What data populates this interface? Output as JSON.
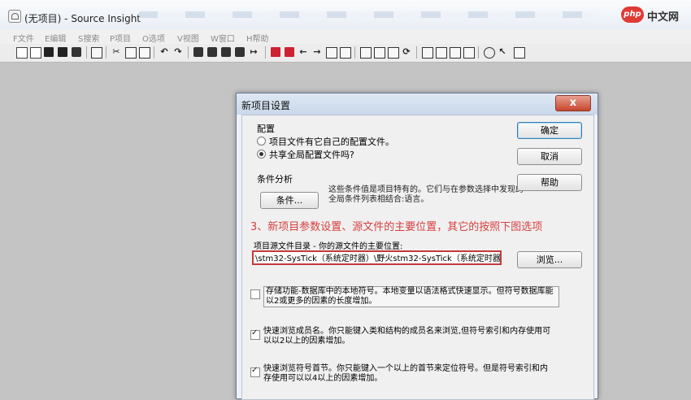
{
  "window": {
    "title": "(无项目) - Source Insight",
    "brand": {
      "badge": "php",
      "text": "中文网"
    }
  },
  "menu": [
    "F文件",
    "E编辑",
    "S搜索",
    "P项目",
    "O选项",
    "V视图",
    "W窗口",
    "H帮助"
  ],
  "toolbar": {
    "icons": [
      "new-file-icon",
      "open-icon",
      "save-icon",
      "save-all-icon",
      "close-file-icon",
      "print-icon",
      "cut-icon",
      "copy-icon",
      "paste-icon",
      "undo-icon",
      "redo-icon",
      "search-icon",
      "search-files-icon",
      "lookup-icon",
      "replace-icon",
      "goto-icon",
      "bookmark-icon",
      "bookmark-list-icon",
      "back-icon",
      "forward-icon",
      "jump-icon",
      "jump-return-icon",
      "project-window-icon",
      "symbol-window-icon",
      "context-window-icon",
      "relation-window-icon",
      "layout-icon",
      "window-icon",
      "split-icon",
      "tile-icon",
      "browse-icon",
      "pointer-icon",
      "more-icon"
    ]
  },
  "dialog": {
    "title": "新项目设置",
    "close_glyph": "x",
    "config_title": "配置",
    "radio_own": "项目文件有它自己的配置文件。",
    "radio_global": "共享全局配置文件吗?",
    "conditions_title": "条件分析",
    "conditions_button": "条件...",
    "conditions_desc": "这些条件值是项目特有的。它们与在参数选择中发现的全局条件列表相结合:语言。",
    "annotation": "3、新项目参数设置、源文件的主要位置，其它的按照下图选项",
    "path_label": "项目源文件目录 - 你的源文件的主要位置:",
    "path_value": "\\stm32-SysTick（系统定时器）\\野火stm32-SysTick（系统定时器）",
    "buttons": {
      "ok": "确定",
      "cancel": "取消",
      "help": "帮助",
      "browse": "浏览..."
    },
    "options": [
      {
        "text": "存储功能-数据库中的本地符号。本地变量以语法格式快速显示。但符号数据库能以2或更多的因素的长度增加。",
        "checked": false
      },
      {
        "text": "快速浏览成员名。你只能键入类和结构的成员名来浏览,但符号索引和内存使用可以以2以上的因素增加。",
        "checked": true
      },
      {
        "text": "快速浏览符号首节。你只能键入一个以上的首节来定位符号。但是符号索引和内存使用可以以4以上的因素增加。",
        "checked": true
      }
    ]
  }
}
